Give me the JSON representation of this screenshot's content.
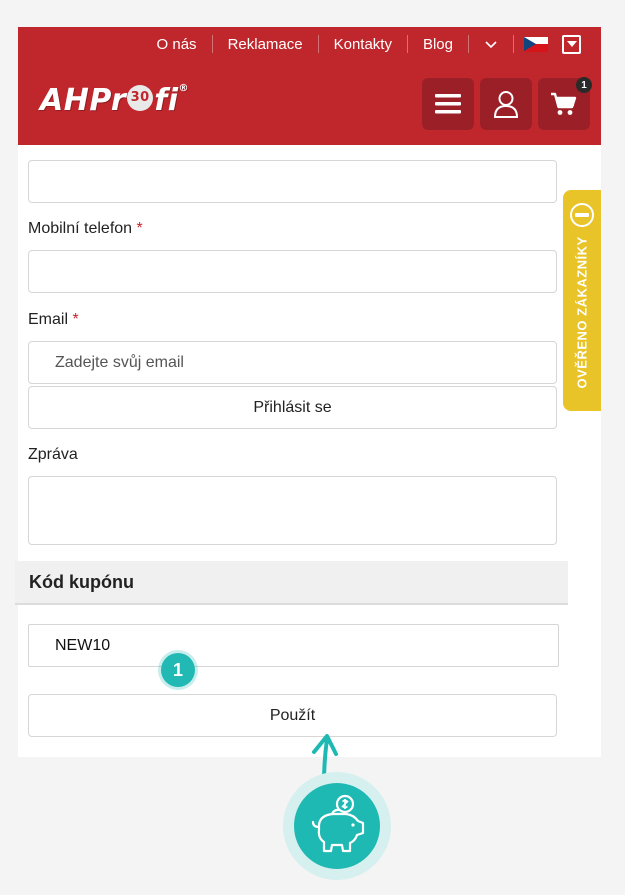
{
  "header": {
    "nav": [
      "O nás",
      "Reklamace",
      "Kontakty",
      "Blog"
    ],
    "logo_text_before": "AHPr",
    "logo_balloon": "30",
    "logo_text_after": "fi",
    "logo_reg": "®",
    "cart_count": "1",
    "icons": [
      "chevron-down-icon",
      "czech-flag-icon",
      "dropdown-box-icon",
      "hamburger-menu-icon",
      "user-icon",
      "cart-icon"
    ]
  },
  "form": {
    "mobile_label": "Mobilní telefon",
    "email_label": "Email",
    "required_mark": "*",
    "email_placeholder": "Zadejte svůj email",
    "login_button": "Přihlásit se",
    "message_label": "Zpráva"
  },
  "coupon": {
    "heading": "Kód kupónu",
    "code_value": "NEW10",
    "apply_button": "Použít",
    "step_number": "1"
  },
  "side_tab": {
    "label": "OVĚŘENO ZÁKAZNÍKY"
  },
  "colors": {
    "brand_red": "#c0272d",
    "dark_red_button": "#9b1f26",
    "teal_accent": "#1fb9b3",
    "side_tab_yellow": "#e9c429"
  }
}
